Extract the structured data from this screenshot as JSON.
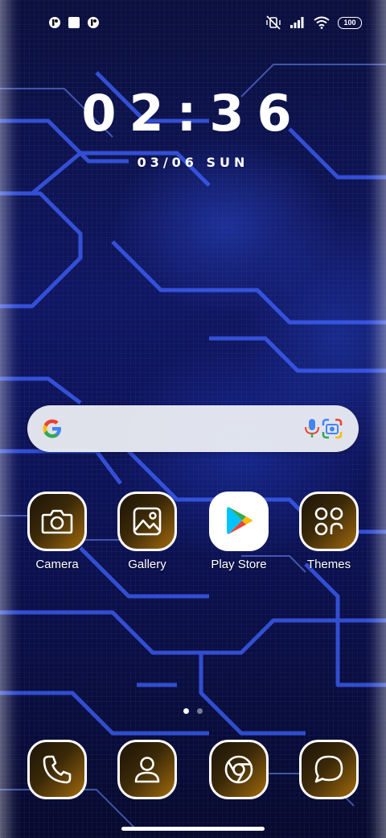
{
  "status_bar": {
    "notification_icons": [
      "app-notification-icon",
      "square-notification-icon",
      "app-notification-icon"
    ],
    "icons": [
      "vibrate-off-icon",
      "signal-icon",
      "wifi-icon"
    ],
    "battery": "100"
  },
  "clock": {
    "time": "02:36",
    "date": "03/06 SUN"
  },
  "search": {
    "logo": "google-g-icon",
    "voice": "mic-icon",
    "lens": "lens-icon"
  },
  "apps": [
    {
      "label": "Camera",
      "icon": "camera-icon"
    },
    {
      "label": "Gallery",
      "icon": "gallery-icon"
    },
    {
      "label": "Play Store",
      "icon": "play-store-icon"
    },
    {
      "label": "Themes",
      "icon": "themes-icon"
    }
  ],
  "dock": [
    {
      "icon": "phone-icon"
    },
    {
      "icon": "contacts-icon"
    },
    {
      "icon": "chrome-icon"
    },
    {
      "icon": "messages-icon"
    }
  ],
  "pages": {
    "count": 2,
    "active": 1
  },
  "colors": {
    "wallpaper": "#101660",
    "icon_gradient_start": "#1c1408",
    "icon_gradient_end": "#a0690d",
    "circuit_line": "#3f63ff"
  }
}
